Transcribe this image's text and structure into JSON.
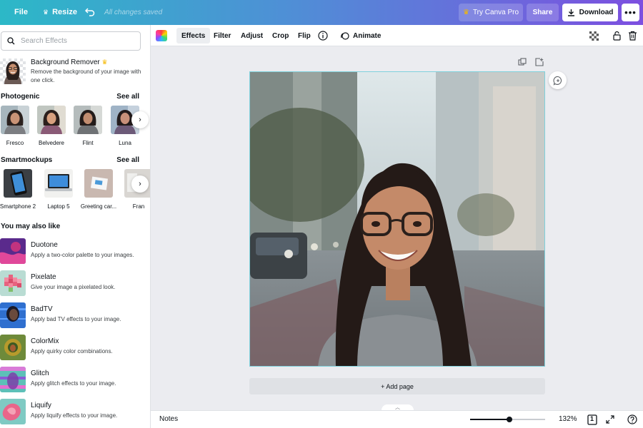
{
  "topbar": {
    "file_label": "File",
    "resize_label": "Resize",
    "saved_status": "All changes saved",
    "try_pro_label": "Try Canva Pro",
    "share_label": "Share",
    "download_label": "Download",
    "more_label": "•••"
  },
  "panel": {
    "search_placeholder": "Search Effects",
    "background_remover": {
      "title": "Background Remover",
      "description": "Remove the background of your image with one click."
    },
    "photogenic": {
      "title": "Photogenic",
      "see_all": "See all",
      "items": [
        "Fresco",
        "Belvedere",
        "Flint",
        "Luna"
      ]
    },
    "smartmockups": {
      "title": "Smartmockups",
      "see_all": "See all",
      "items": [
        "Smartphone 2",
        "Laptop 5",
        "Greeting car...",
        "Fran"
      ]
    },
    "also_like": {
      "title": "You may also like",
      "items": [
        {
          "title": "Duotone",
          "description": "Apply a two-color palette to your images."
        },
        {
          "title": "Pixelate",
          "description": "Give your image a pixelated look."
        },
        {
          "title": "BadTV",
          "description": "Apply bad TV effects to your image."
        },
        {
          "title": "ColorMix",
          "description": "Apply quirky color combinations."
        },
        {
          "title": "Glitch",
          "description": "Apply glitch effects to your image."
        },
        {
          "title": "Liquify",
          "description": "Apply liquify effects to your image."
        }
      ]
    }
  },
  "toolbar": {
    "effects": "Effects",
    "filter": "Filter",
    "adjust": "Adjust",
    "crop": "Crop",
    "flip": "Flip",
    "animate": "Animate"
  },
  "canvas": {
    "add_page": "+ Add page"
  },
  "bottombar": {
    "notes": "Notes",
    "zoom_level": "132%",
    "zoom_fraction": 0.52,
    "page_count": "1"
  },
  "colors": {
    "accent": "#7d4fe0",
    "selection": "#7fd1dc",
    "gradient_start": "#2cb8c7",
    "gradient_end": "#7d4fe0"
  }
}
